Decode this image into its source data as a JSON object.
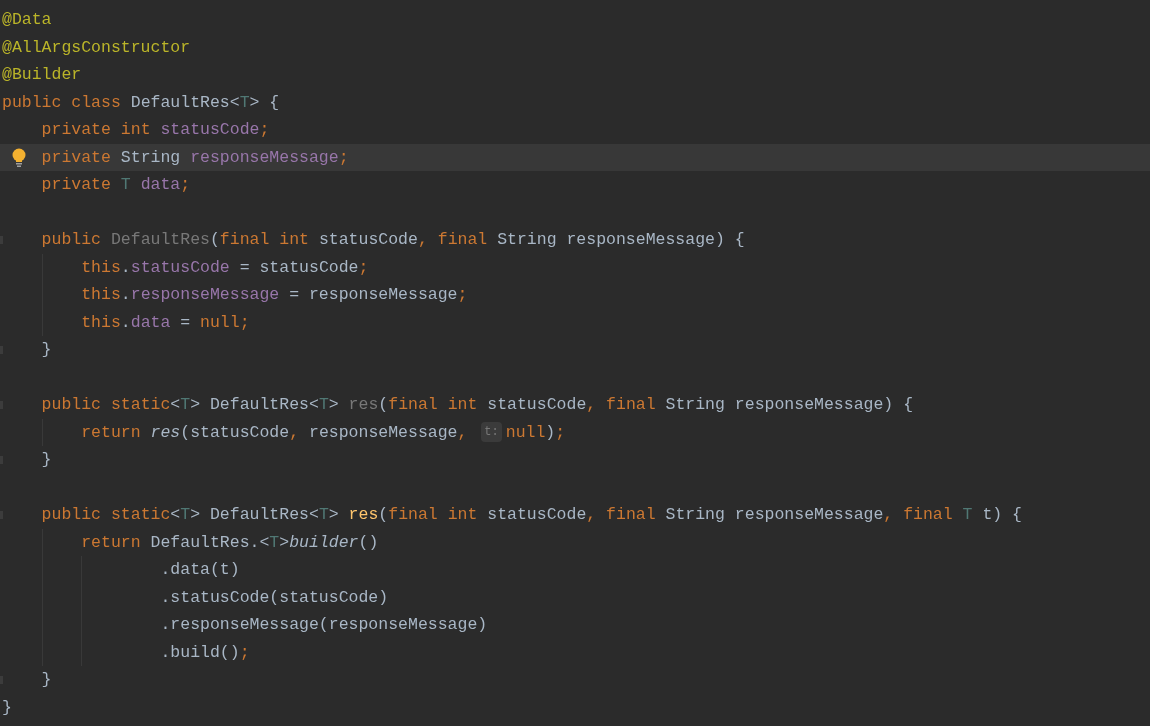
{
  "editor": {
    "lines": [
      {
        "kind": "code",
        "current": false,
        "bulb": false,
        "fold": false,
        "tokens": [
          {
            "kind": "annotation",
            "text": "@Data"
          }
        ]
      },
      {
        "kind": "code",
        "current": false,
        "bulb": false,
        "fold": false,
        "tokens": [
          {
            "kind": "annotation",
            "text": "@AllArgsConstructor"
          }
        ]
      },
      {
        "kind": "code",
        "current": false,
        "bulb": false,
        "fold": false,
        "tokens": [
          {
            "kind": "annotation",
            "text": "@Builder"
          }
        ]
      },
      {
        "kind": "code",
        "current": false,
        "bulb": false,
        "fold": false,
        "tokens": [
          {
            "kind": "keyword",
            "text": "public class "
          },
          {
            "kind": "plain",
            "text": "DefaultRes<"
          },
          {
            "kind": "typeparam",
            "text": "T"
          },
          {
            "kind": "plain",
            "text": "> {"
          }
        ]
      },
      {
        "kind": "code",
        "current": false,
        "bulb": false,
        "fold": false,
        "tokens": [
          {
            "kind": "keyword",
            "text": "    private int "
          },
          {
            "kind": "field",
            "text": "statusCode"
          },
          {
            "kind": "keyword",
            "text": ";"
          }
        ]
      },
      {
        "kind": "code",
        "current": true,
        "bulb": true,
        "fold": false,
        "tokens": [
          {
            "kind": "keyword",
            "text": "    private "
          },
          {
            "kind": "plain",
            "text": "String "
          },
          {
            "kind": "field",
            "text": "responseMessage"
          },
          {
            "kind": "keyword",
            "text": ";"
          }
        ]
      },
      {
        "kind": "code",
        "current": false,
        "bulb": false,
        "fold": false,
        "tokens": [
          {
            "kind": "keyword",
            "text": "    private "
          },
          {
            "kind": "typeparam",
            "text": "T"
          },
          {
            "kind": "field",
            "text": " data"
          },
          {
            "kind": "keyword",
            "text": ";"
          }
        ]
      },
      {
        "kind": "blank"
      },
      {
        "kind": "code",
        "current": false,
        "bulb": false,
        "fold": true,
        "tokens": [
          {
            "kind": "keyword",
            "text": "    public "
          },
          {
            "kind": "unused",
            "text": "DefaultRes"
          },
          {
            "kind": "plain",
            "text": "("
          },
          {
            "kind": "keyword",
            "text": "final int "
          },
          {
            "kind": "plain",
            "text": "statusCode"
          },
          {
            "kind": "keyword",
            "text": ", final "
          },
          {
            "kind": "plain",
            "text": "String responseMessage) {"
          }
        ]
      },
      {
        "kind": "code",
        "current": false,
        "bulb": false,
        "fold": false,
        "tokens": [
          {
            "kind": "keyword",
            "text": "        this"
          },
          {
            "kind": "plain",
            "text": "."
          },
          {
            "kind": "field",
            "text": "statusCode"
          },
          {
            "kind": "plain",
            "text": " = statusCode"
          },
          {
            "kind": "keyword",
            "text": ";"
          }
        ]
      },
      {
        "kind": "code",
        "current": false,
        "bulb": false,
        "fold": false,
        "tokens": [
          {
            "kind": "keyword",
            "text": "        this"
          },
          {
            "kind": "plain",
            "text": "."
          },
          {
            "kind": "field",
            "text": "responseMessage"
          },
          {
            "kind": "plain",
            "text": " = responseMessage"
          },
          {
            "kind": "keyword",
            "text": ";"
          }
        ]
      },
      {
        "kind": "code",
        "current": false,
        "bulb": false,
        "fold": false,
        "tokens": [
          {
            "kind": "keyword",
            "text": "        this"
          },
          {
            "kind": "plain",
            "text": "."
          },
          {
            "kind": "field",
            "text": "data"
          },
          {
            "kind": "plain",
            "text": " = "
          },
          {
            "kind": "keyword",
            "text": "null;"
          }
        ]
      },
      {
        "kind": "code",
        "current": false,
        "bulb": false,
        "fold": true,
        "tokens": [
          {
            "kind": "plain",
            "text": "    }"
          }
        ]
      },
      {
        "kind": "blank"
      },
      {
        "kind": "code",
        "current": false,
        "bulb": false,
        "fold": true,
        "tokens": [
          {
            "kind": "keyword",
            "text": "    public static"
          },
          {
            "kind": "plain",
            "text": "<"
          },
          {
            "kind": "typeparam",
            "text": "T"
          },
          {
            "kind": "plain",
            "text": "> DefaultRes<"
          },
          {
            "kind": "typeparam",
            "text": "T"
          },
          {
            "kind": "plain",
            "text": "> "
          },
          {
            "kind": "unused",
            "text": "res"
          },
          {
            "kind": "plain",
            "text": "("
          },
          {
            "kind": "keyword",
            "text": "final int "
          },
          {
            "kind": "plain",
            "text": "statusCode"
          },
          {
            "kind": "keyword",
            "text": ", final "
          },
          {
            "kind": "plain",
            "text": "String responseMessage) {"
          }
        ]
      },
      {
        "kind": "code",
        "current": false,
        "bulb": false,
        "fold": false,
        "tokens": [
          {
            "kind": "keyword",
            "text": "        return "
          },
          {
            "kind": "call",
            "text": "res"
          },
          {
            "kind": "plain",
            "text": "(statusCode"
          },
          {
            "kind": "keyword",
            "text": ", "
          },
          {
            "kind": "plain",
            "text": "responseMessage"
          },
          {
            "kind": "keyword",
            "text": ", "
          },
          {
            "kind": "hint",
            "text": "t:"
          },
          {
            "kind": "keyword",
            "text": "null"
          },
          {
            "kind": "plain",
            "text": ")"
          },
          {
            "kind": "keyword",
            "text": ";"
          }
        ]
      },
      {
        "kind": "code",
        "current": false,
        "bulb": false,
        "fold": true,
        "tokens": [
          {
            "kind": "plain",
            "text": "    }"
          }
        ]
      },
      {
        "kind": "blank"
      },
      {
        "kind": "code",
        "current": false,
        "bulb": false,
        "fold": true,
        "tokens": [
          {
            "kind": "keyword",
            "text": "    public static"
          },
          {
            "kind": "plain",
            "text": "<"
          },
          {
            "kind": "typeparam",
            "text": "T"
          },
          {
            "kind": "plain",
            "text": "> DefaultRes<"
          },
          {
            "kind": "typeparam",
            "text": "T"
          },
          {
            "kind": "plain",
            "text": "> "
          },
          {
            "kind": "method",
            "text": "res"
          },
          {
            "kind": "plain",
            "text": "("
          },
          {
            "kind": "keyword",
            "text": "final int "
          },
          {
            "kind": "plain",
            "text": "statusCode"
          },
          {
            "kind": "keyword",
            "text": ", final "
          },
          {
            "kind": "plain",
            "text": "String responseMessage"
          },
          {
            "kind": "keyword",
            "text": ", final "
          },
          {
            "kind": "typeparam",
            "text": "T"
          },
          {
            "kind": "plain",
            "text": " t) {"
          }
        ]
      },
      {
        "kind": "code",
        "current": false,
        "bulb": false,
        "fold": false,
        "tokens": [
          {
            "kind": "keyword",
            "text": "        return "
          },
          {
            "kind": "plain",
            "text": "DefaultRes.<"
          },
          {
            "kind": "typeparam",
            "text": "T"
          },
          {
            "kind": "plain",
            "text": ">"
          },
          {
            "kind": "call",
            "text": "builder"
          },
          {
            "kind": "plain",
            "text": "()"
          }
        ]
      },
      {
        "kind": "code",
        "current": false,
        "bulb": false,
        "fold": false,
        "tokens": [
          {
            "kind": "plain",
            "text": "                .data(t)"
          }
        ]
      },
      {
        "kind": "code",
        "current": false,
        "bulb": false,
        "fold": false,
        "tokens": [
          {
            "kind": "plain",
            "text": "                .statusCode(statusCode)"
          }
        ]
      },
      {
        "kind": "code",
        "current": false,
        "bulb": false,
        "fold": false,
        "tokens": [
          {
            "kind": "plain",
            "text": "                .responseMessage(responseMessage)"
          }
        ]
      },
      {
        "kind": "code",
        "current": false,
        "bulb": false,
        "fold": false,
        "tokens": [
          {
            "kind": "plain",
            "text": "                .build()"
          },
          {
            "kind": "keyword",
            "text": ";"
          }
        ]
      },
      {
        "kind": "code",
        "current": false,
        "bulb": false,
        "fold": true,
        "tokens": [
          {
            "kind": "plain",
            "text": "    }"
          }
        ]
      },
      {
        "kind": "code",
        "current": false,
        "bulb": false,
        "fold": false,
        "tokens": [
          {
            "kind": "plain",
            "text": "}"
          }
        ]
      }
    ]
  }
}
